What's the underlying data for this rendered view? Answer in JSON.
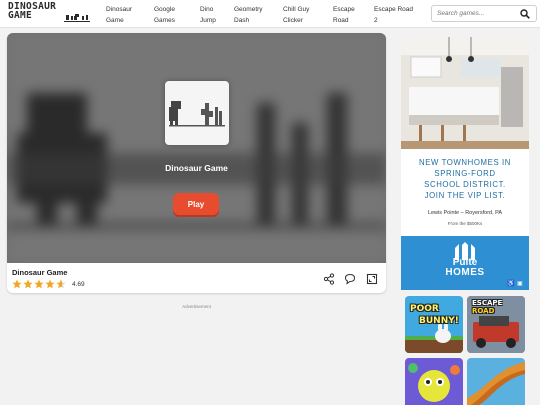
{
  "header": {
    "logo_line1": "DINOSAUR",
    "logo_line2": "GAME",
    "nav": [
      {
        "label": "Dinosaur\nGame"
      },
      {
        "label": "Google\nGames"
      },
      {
        "label": "Dino\nJump"
      },
      {
        "label": "Geometry\nDash"
      },
      {
        "label": "Chill Guy\nClicker"
      },
      {
        "label": "Escape\nRoad"
      },
      {
        "label": "Escape Road\n2"
      }
    ],
    "search_placeholder": "Search games..."
  },
  "game": {
    "overlay_title": "Dinosaur Game",
    "play_label": "Play",
    "title": "Dinosaur Game",
    "rating": "4.69",
    "stars_value": 4.69,
    "stars_max": 5
  },
  "advertisement_label": "Advertisement",
  "ad": {
    "headline_1": "NEW TOWNHOMES IN",
    "headline_2": "SPRING-FORD",
    "headline_3": "SCHOOL DISTRICT.",
    "headline_4": "JOIN THE VIP LIST.",
    "location": "Lewis Pointe – Royersford, PA",
    "price": "From the $500Ks",
    "brand_1": "Pulte",
    "brand_2": "HOMES"
  },
  "related": {
    "tile1_line1": "POOR",
    "tile1_line2": "BUNNY!",
    "tile2_line1": "ESCAPE",
    "tile2_line2": "ROAD"
  },
  "colors": {
    "play": "#e74c2e",
    "ad_accent": "#1f6ea3",
    "brand_blue": "#2f8fd3",
    "star": "#f2a623"
  }
}
